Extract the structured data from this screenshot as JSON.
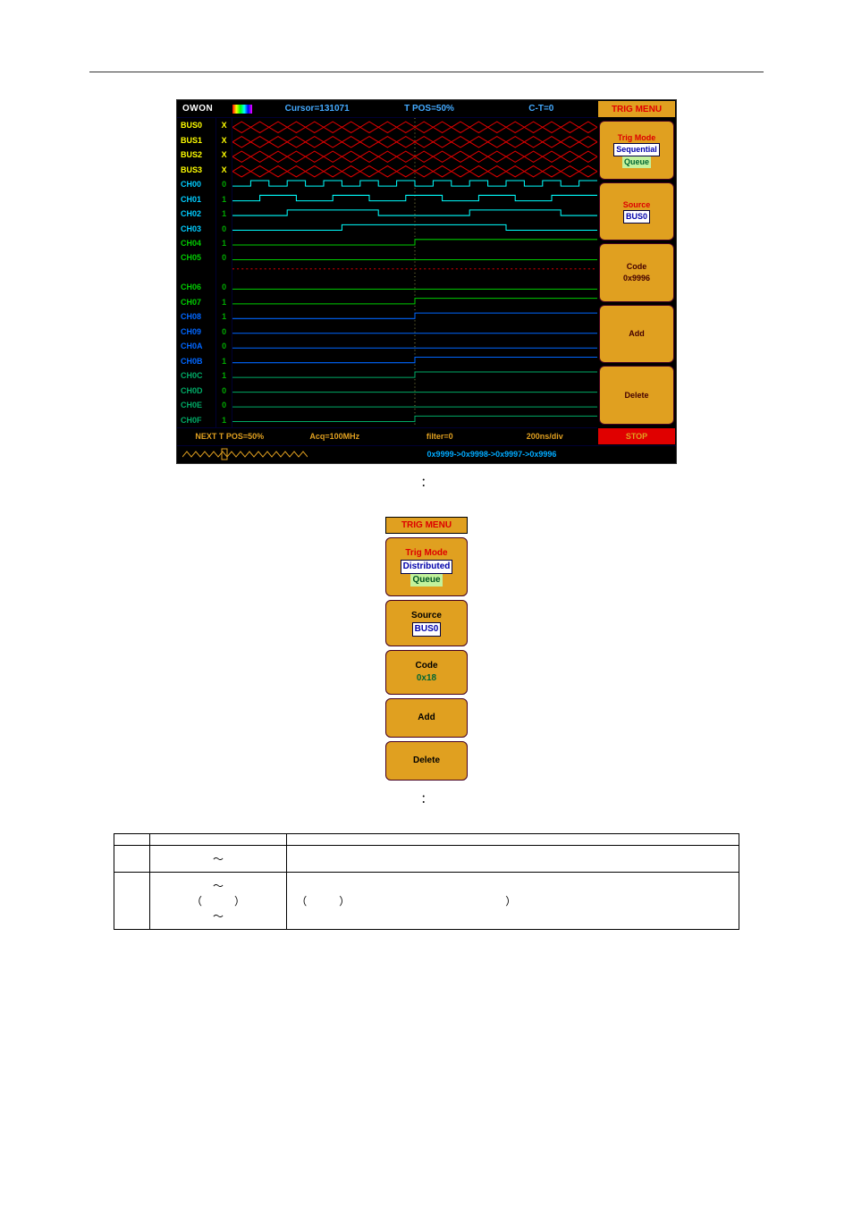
{
  "topbar": {
    "logo": "OWON",
    "cursor": "Cursor=131071",
    "tpos": "T POS=50%",
    "ct": "C-T=0"
  },
  "trigmenu_header": "TRIG MENU",
  "channels": [
    {
      "label": "BUS0",
      "v": "X",
      "cls": "bus"
    },
    {
      "label": "BUS1",
      "v": "X",
      "cls": "bus"
    },
    {
      "label": "BUS2",
      "v": "X",
      "cls": "bus"
    },
    {
      "label": "BUS3",
      "v": "X",
      "cls": "bus"
    },
    {
      "label": "CH00",
      "v": "0",
      "cls": "g1"
    },
    {
      "label": "CH01",
      "v": "1",
      "cls": "g1"
    },
    {
      "label": "CH02",
      "v": "1",
      "cls": "g1"
    },
    {
      "label": "CH03",
      "v": "0",
      "cls": "g1"
    },
    {
      "label": "CH04",
      "v": "1",
      "cls": "g2"
    },
    {
      "label": "CH05",
      "v": "0",
      "cls": "g2"
    },
    {
      "label": "",
      "v": "",
      "cls": "g2"
    },
    {
      "label": "CH06",
      "v": "0",
      "cls": "g2"
    },
    {
      "label": "CH07",
      "v": "1",
      "cls": "g2"
    },
    {
      "label": "CH08",
      "v": "1",
      "cls": "g3"
    },
    {
      "label": "CH09",
      "v": "0",
      "cls": "g3"
    },
    {
      "label": "CH0A",
      "v": "0",
      "cls": "g3"
    },
    {
      "label": "CH0B",
      "v": "1",
      "cls": "g3"
    },
    {
      "label": "CH0C",
      "v": "1",
      "cls": "g4"
    },
    {
      "label": "CH0D",
      "v": "0",
      "cls": "g4"
    },
    {
      "label": "CH0E",
      "v": "0",
      "cls": "g4"
    },
    {
      "label": "CH0F",
      "v": "1",
      "cls": "g4"
    }
  ],
  "menu1": {
    "trigmode_lbl": "Trig Mode",
    "trigmode_v1": "Sequential",
    "trigmode_v2": "Queue",
    "source_lbl": "Source",
    "source_val": "BUS0",
    "code_lbl": "Code",
    "code_val": "0x9996",
    "add": "Add",
    "delete": "Delete"
  },
  "bottom": {
    "next_tpos": "NEXT T POS=50%",
    "acq": "Acq=100MHz",
    "filter": "filter=0",
    "timediv": "200ns/div",
    "stop": "STOP",
    "seq": "0x9999->0x9998->0x9997->0x9996"
  },
  "fig1_caption": "：",
  "menu2_header": "TRIG MENU",
  "menu2": {
    "trigmode_lbl": "Trig Mode",
    "trigmode_v1": "Distributed",
    "trigmode_v2": "Queue",
    "source_lbl": "Source",
    "source_val": "BUS0",
    "code_lbl": "Code",
    "code_val": "0x18",
    "add": "Add",
    "delete": "Delete"
  },
  "fig2_caption": "：",
  "table": {
    "r1": {
      "c1": "",
      "c2": "",
      "c3": ""
    },
    "r2": {
      "c1": "",
      "c2": "～",
      "c3": ""
    },
    "r3": {
      "c1": "",
      "c2_line1": "～",
      "c2_line2": "（　　　）",
      "c2_line3": "～",
      "c3": "（　　　）　　　　　　　　　　　　　　　）"
    }
  }
}
